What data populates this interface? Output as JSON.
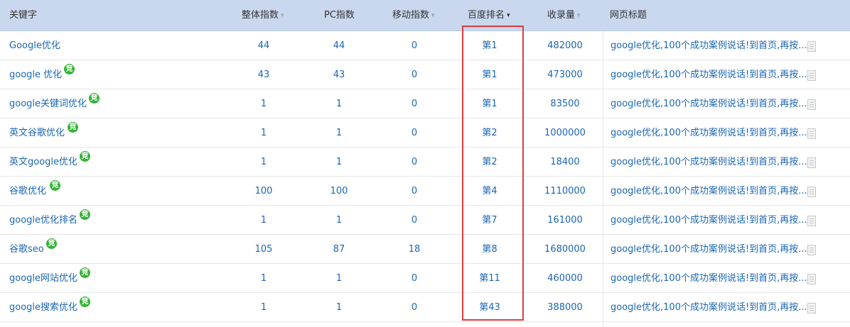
{
  "header": {
    "keyword": "关键字",
    "overall_index": "整体指数",
    "pc_index": "PC指数",
    "mobile_index": "移动指数",
    "baidu_rank": "百度排名",
    "indexed_count": "收录量",
    "page_title": "网页标题",
    "sort_down": "▾"
  },
  "badge_label": "竞",
  "rows": [
    {
      "keyword": "Google优化",
      "has_badge": false,
      "overall": "44",
      "pc": "44",
      "mobile": "0",
      "rank": "第1",
      "indexed": "482000",
      "title": "google优化,100个成功案例说话!到首页,再按..."
    },
    {
      "keyword": "google 优化",
      "has_badge": true,
      "overall": "43",
      "pc": "43",
      "mobile": "0",
      "rank": "第1",
      "indexed": "473000",
      "title": "google优化,100个成功案例说话!到首页,再按..."
    },
    {
      "keyword": "google关键词优化",
      "has_badge": true,
      "overall": "1",
      "pc": "1",
      "mobile": "0",
      "rank": "第1",
      "indexed": "83500",
      "title": "google优化,100个成功案例说话!到首页,再按..."
    },
    {
      "keyword": "英文谷歌优化",
      "has_badge": true,
      "overall": "1",
      "pc": "1",
      "mobile": "0",
      "rank": "第2",
      "indexed": "1000000",
      "title": "google优化,100个成功案例说话!到首页,再按..."
    },
    {
      "keyword": "英文google优化",
      "has_badge": true,
      "overall": "1",
      "pc": "1",
      "mobile": "0",
      "rank": "第2",
      "indexed": "18400",
      "title": "google优化,100个成功案例说话!到首页,再按..."
    },
    {
      "keyword": "谷歌优化",
      "has_badge": true,
      "overall": "100",
      "pc": "100",
      "mobile": "0",
      "rank": "第4",
      "indexed": "1110000",
      "title": "google优化,100个成功案例说话!到首页,再按..."
    },
    {
      "keyword": "google优化排名",
      "has_badge": true,
      "overall": "1",
      "pc": "1",
      "mobile": "0",
      "rank": "第7",
      "indexed": "161000",
      "title": "google优化,100个成功案例说话!到首页,再按..."
    },
    {
      "keyword": "谷歌seo",
      "has_badge": true,
      "overall": "105",
      "pc": "87",
      "mobile": "18",
      "rank": "第8",
      "indexed": "1680000",
      "title": "google优化,100个成功案例说话!到首页,再按..."
    },
    {
      "keyword": "google网站优化",
      "has_badge": true,
      "overall": "1",
      "pc": "1",
      "mobile": "0",
      "rank": "第11",
      "indexed": "460000",
      "title": "google优化,100个成功案例说话!到首页,再按..."
    },
    {
      "keyword": "google搜索优化",
      "has_badge": true,
      "overall": "1",
      "pc": "1",
      "mobile": "0",
      "rank": "第43",
      "indexed": "388000",
      "title": "google优化,100个成功案例说话!到首页,再按..."
    }
  ],
  "colors": {
    "header_bg": "#c9d8ee",
    "link": "#1a66b3",
    "badge": "#35b335",
    "highlight": "#e03c3c"
  }
}
